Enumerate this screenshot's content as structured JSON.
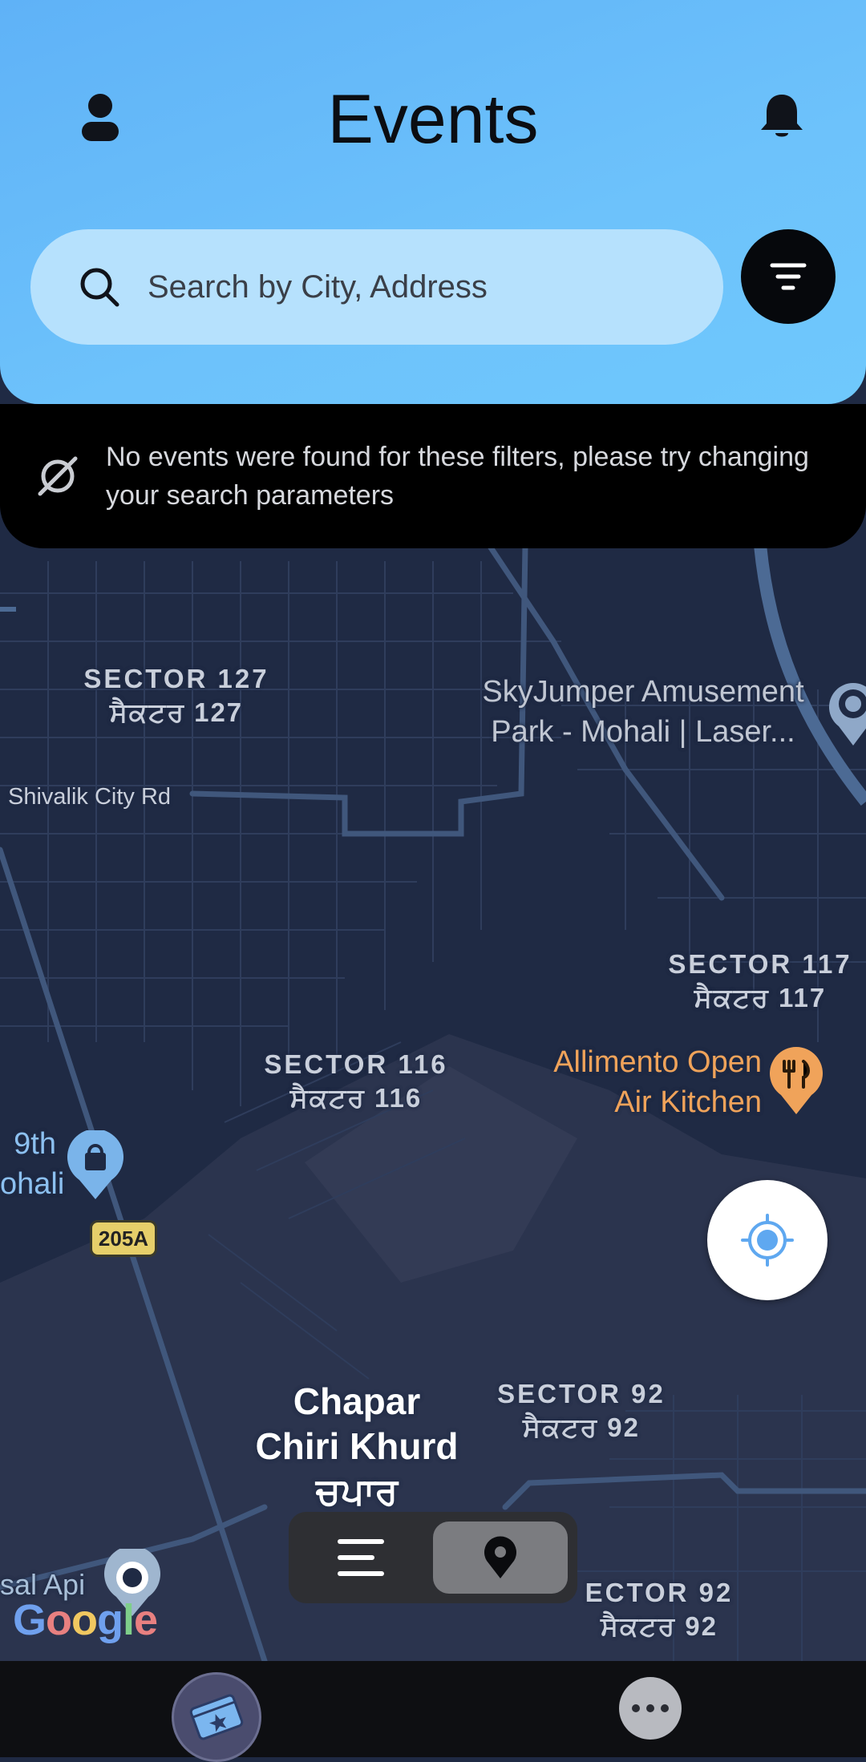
{
  "header": {
    "title": "Events",
    "search_placeholder": "Search by City, Address",
    "icons": {
      "profile": "person-icon",
      "notifications": "bell-icon",
      "search": "search-icon",
      "filter": "filter-icon"
    }
  },
  "notice": {
    "icon": "no-results-icon",
    "text": "No events were found for these filters, please try changing your search parameters"
  },
  "map": {
    "labels": {
      "sector127": {
        "en": "SECTOR 127",
        "pa": "ਸੈਕਟਰ 127"
      },
      "sector117": {
        "en": "SECTOR 117",
        "pa": "ਸੈਕਟਰ 117"
      },
      "sector116": {
        "en": "SECTOR 116",
        "pa": "ਸੈਕਟਰ 116"
      },
      "sector92a": {
        "en": "SECTOR 92",
        "pa": "ਸੈਕਟਰ 92"
      },
      "sector92b": {
        "en": "ECTOR 92",
        "pa": "ਸੈਕਟਰ 92"
      }
    },
    "road": "Shivalik City Rd",
    "highway_shield": "205A",
    "poi_skyjumper": [
      "SkyJumper Amusement",
      "Park - Mohali | Laser..."
    ],
    "poi_allimento": [
      "Allimento Open",
      "Air Kitchen"
    ],
    "poi_left": [
      "9th",
      "ohali"
    ],
    "poi_bottom_left": "sal Api",
    "place": [
      "Chapar",
      "Chiri Khurd",
      "ਚਪਾਰ"
    ],
    "attribution": "Google",
    "colors": {
      "background": "#1f2a44",
      "road": "#3f5a80",
      "poi_food": "#f0a35a",
      "accent": "#5fb2f7"
    }
  },
  "view_toggle": {
    "list_icon": "list-icon",
    "map_icon": "map-pin-icon",
    "active": "map"
  },
  "locate": {
    "icon": "my-location-icon"
  },
  "bottom_nav": {
    "events_icon": "ticket-icon",
    "more_icon": "more-dots-icon"
  }
}
